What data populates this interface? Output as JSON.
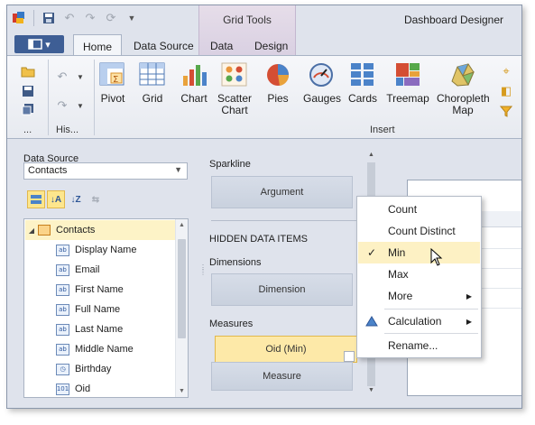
{
  "app": {
    "title": "Dashboard Designer",
    "context_group": "Grid Tools"
  },
  "tabs": [
    {
      "label": "Home",
      "active": true
    },
    {
      "label": "Data Source",
      "active": false
    },
    {
      "label": "Data",
      "active": false
    },
    {
      "label": "Design",
      "active": false
    }
  ],
  "ribbon": {
    "groups": {
      "history": "His...",
      "more": "...",
      "insert": "Insert"
    },
    "insert_buttons": [
      {
        "label": "Pivot",
        "icon": "pivot-icon"
      },
      {
        "label": "Grid",
        "icon": "grid-icon"
      },
      {
        "label": "Chart",
        "icon": "chart-icon"
      },
      {
        "label": "Scatter Chart",
        "icon": "scatter-chart-icon"
      },
      {
        "label": "Pies",
        "icon": "pies-icon"
      },
      {
        "label": "Gauges",
        "icon": "gauges-icon"
      },
      {
        "label": "Cards",
        "icon": "cards-icon"
      },
      {
        "label": "Treemap",
        "icon": "treemap-icon"
      },
      {
        "label": "Choropleth Map",
        "icon": "choropleth-map-icon"
      }
    ]
  },
  "data_source": {
    "label": "Data Source",
    "selected": "Contacts",
    "tree_root": "Contacts",
    "fields": [
      {
        "name": "Display Name",
        "type": "ab"
      },
      {
        "name": "Email",
        "type": "ab"
      },
      {
        "name": "First Name",
        "type": "ab"
      },
      {
        "name": "Full Name",
        "type": "ab"
      },
      {
        "name": "Last Name",
        "type": "ab"
      },
      {
        "name": "Middle Name",
        "type": "ab"
      },
      {
        "name": "Birthday",
        "type": "date"
      },
      {
        "name": "Oid",
        "type": "101"
      }
    ]
  },
  "binding": {
    "sparkline_label": "Sparkline",
    "argument_label": "Argument",
    "hidden_header": "HIDDEN DATA ITEMS",
    "dimensions_label": "Dimensions",
    "dimension_placeholder": "Dimension",
    "measures_label": "Measures",
    "measure_item": "Oid (Min)",
    "measure_placeholder": "Measure"
  },
  "context_menu": {
    "items": [
      {
        "label": "Count"
      },
      {
        "label": "Count Distinct"
      },
      {
        "label": "Min",
        "checked": true
      },
      {
        "label": "Max"
      },
      {
        "label": "More",
        "submenu": true
      },
      {
        "label": "Calculation",
        "submenu": true
      },
      {
        "label": "Rename..."
      }
    ],
    "check_glyph": "✓",
    "submenu_glyph": "▶"
  },
  "colors": {
    "accent": "#3e5e95",
    "highlight": "#fdf1c4",
    "ribbon_bg": "#f3f5f9"
  }
}
